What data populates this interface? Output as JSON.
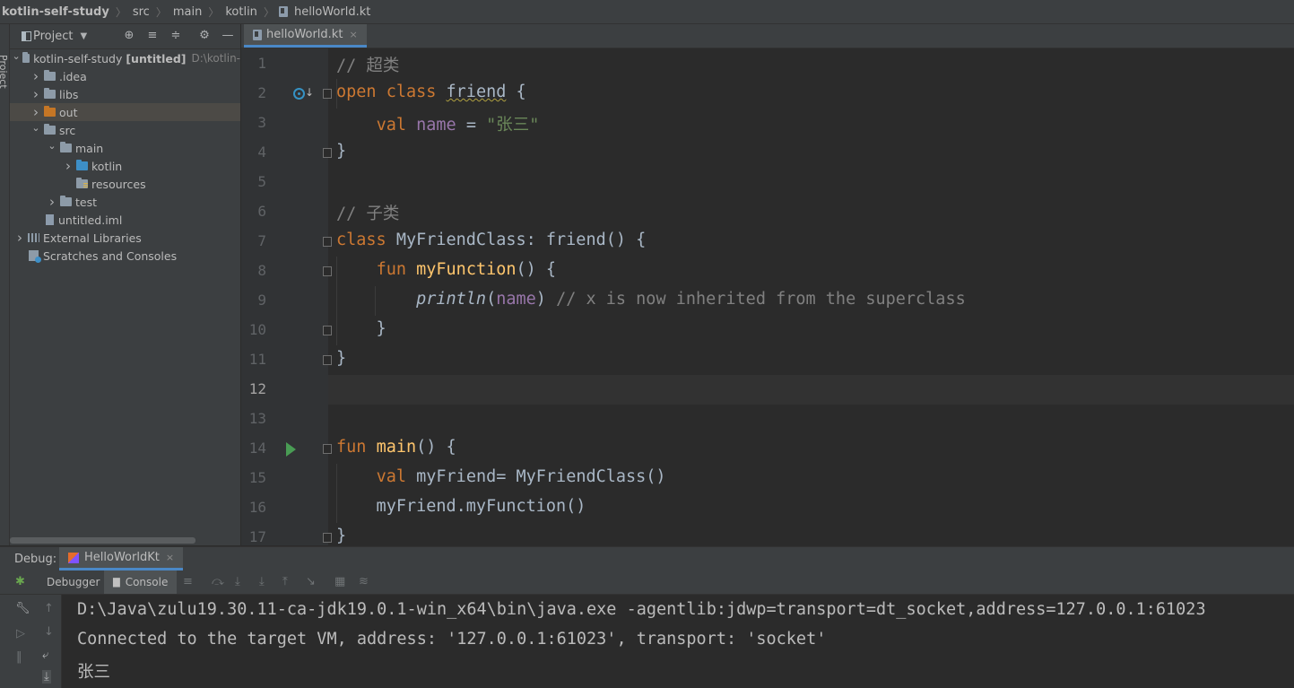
{
  "breadcrumb": {
    "project": "kotlin-self-study",
    "items": [
      "src",
      "main",
      "kotlin"
    ],
    "file": "helloWorld.kt"
  },
  "sidebar_strip": {
    "label": "Project"
  },
  "project_panel": {
    "title": "Project",
    "tree": [
      {
        "label": "kotlin-self-study [untitled]",
        "hint": "D:\\kotlin-",
        "level": 0,
        "arrow": "v",
        "icon": "folder"
      },
      {
        "label": ".idea",
        "level": 1,
        "arrow": ">",
        "icon": "folder"
      },
      {
        "label": "libs",
        "level": 1,
        "arrow": ">",
        "icon": "folder"
      },
      {
        "label": "out",
        "level": 1,
        "arrow": ">",
        "icon": "folder-orange",
        "selected": true
      },
      {
        "label": "src",
        "level": 1,
        "arrow": "v",
        "icon": "folder"
      },
      {
        "label": "main",
        "level": 2,
        "arrow": "v",
        "icon": "folder"
      },
      {
        "label": "kotlin",
        "level": 3,
        "arrow": ">",
        "icon": "folder-blue"
      },
      {
        "label": "resources",
        "level": 3,
        "arrow": "",
        "icon": "folder-resources"
      },
      {
        "label": "test",
        "level": 2,
        "arrow": ">",
        "icon": "folder"
      },
      {
        "label": "untitled.iml",
        "level": 1,
        "arrow": "",
        "icon": "file"
      },
      {
        "label": "External Libraries",
        "level": 0,
        "arrow": ">",
        "icon": "library"
      },
      {
        "label": "Scratches and Consoles",
        "level": 0,
        "arrow": "",
        "icon": "scratch"
      }
    ]
  },
  "editor_tab": {
    "label": "helloWorld.kt",
    "close": "×"
  },
  "editor": {
    "current_line": 12,
    "line_numbers": [
      "1",
      "2",
      "3",
      "4",
      "5",
      "6",
      "7",
      "8",
      "9",
      "10",
      "11",
      "12",
      "13",
      "14",
      "15",
      "16",
      "17"
    ],
    "lines": [
      [
        {
          "t": "// 超类",
          "c": "cmt"
        }
      ],
      [
        {
          "t": "open ",
          "c": "kw"
        },
        {
          "t": "class ",
          "c": "kw"
        },
        {
          "t": "friend",
          "c": "wavy"
        },
        {
          "t": " {",
          "c": ""
        }
      ],
      [
        {
          "t": "    ",
          "c": ""
        },
        {
          "t": "val ",
          "c": "kw"
        },
        {
          "t": "name",
          "c": "prop"
        },
        {
          "t": " = ",
          "c": ""
        },
        {
          "t": "\"张三\"",
          "c": "str"
        }
      ],
      [
        {
          "t": "}",
          "c": ""
        }
      ],
      [],
      [
        {
          "t": "// 子类",
          "c": "cmt"
        }
      ],
      [
        {
          "t": "class ",
          "c": "kw"
        },
        {
          "t": "MyFriendClass: friend() {",
          "c": ""
        }
      ],
      [
        {
          "t": "    ",
          "c": ""
        },
        {
          "t": "fun ",
          "c": "kw"
        },
        {
          "t": "myFunction",
          "c": "fn"
        },
        {
          "t": "() {",
          "c": ""
        }
      ],
      [
        {
          "t": "        ",
          "c": ""
        },
        {
          "t": "println",
          "c": "it"
        },
        {
          "t": "(",
          "c": ""
        },
        {
          "t": "name",
          "c": "prop"
        },
        {
          "t": ") ",
          "c": ""
        },
        {
          "t": "// x is now inherited from the superclass",
          "c": "cmt"
        }
      ],
      [
        {
          "t": "    }",
          "c": ""
        }
      ],
      [
        {
          "t": "}",
          "c": ""
        }
      ],
      [],
      [],
      [
        {
          "t": "fun ",
          "c": "kw"
        },
        {
          "t": "main",
          "c": "fn"
        },
        {
          "t": "() {",
          "c": ""
        }
      ],
      [
        {
          "t": "    ",
          "c": ""
        },
        {
          "t": "val ",
          "c": "kw"
        },
        {
          "t": "myFriend= MyFriendClass()",
          "c": ""
        }
      ],
      [
        {
          "t": "    myFriend.myFunction()",
          "c": ""
        }
      ],
      [
        {
          "t": "}",
          "c": ""
        }
      ]
    ]
  },
  "debug": {
    "label": "Debug:",
    "config_tab": "HelloWorldKt",
    "debugger_tab": "Debugger",
    "console_tab": "Console",
    "console_lines": [
      "D:\\Java\\zulu19.30.11-ca-jdk19.0.1-win_x64\\bin\\java.exe -agentlib:jdwp=transport=dt_socket,address=127.0.0.1:61023",
      "Connected to the target VM, address: '127.0.0.1:61023', transport: 'socket'",
      "张三"
    ]
  },
  "icons": {
    "gutter_line_2": "overridden-icon",
    "gutter_line_14": "run-icon"
  },
  "colors": {
    "keyword": "#cc7832",
    "comment": "#808080",
    "string": "#6a8759",
    "function": "#ffc66d",
    "property": "#9876aa",
    "tab_accent": "#4a88c7"
  }
}
